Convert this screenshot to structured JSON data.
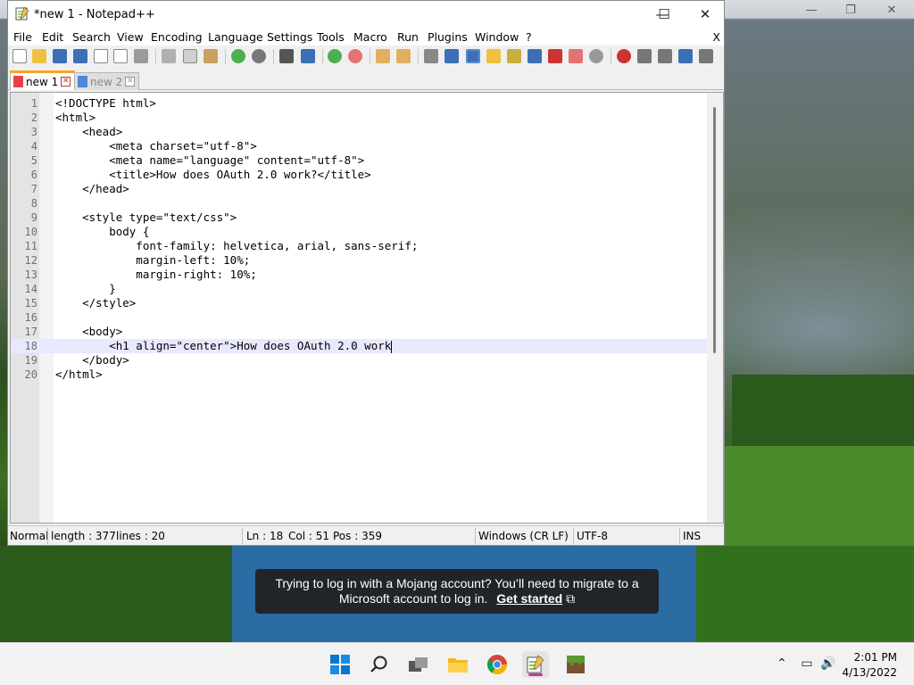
{
  "window": {
    "title": "*new 1 - Notepad++",
    "minimize": "—",
    "maximize": "☐",
    "close": "✕"
  },
  "menubar": {
    "items": [
      "File",
      "Edit",
      "Search",
      "View",
      "Encoding",
      "Language",
      "Settings",
      "Tools",
      "Macro",
      "Run",
      "Plugins",
      "Window",
      "?"
    ],
    "close_doc": "X"
  },
  "tabs": [
    {
      "label": "new 1",
      "active": true,
      "color": "#e8404a"
    },
    {
      "label": "new 2",
      "active": false,
      "color": "#4a8ad8"
    }
  ],
  "editor": {
    "current_line": 18,
    "lines": [
      {
        "n": "1",
        "text": "<!DOCTYPE html>"
      },
      {
        "n": "2",
        "text": "<html>"
      },
      {
        "n": "3",
        "text": "    <head>"
      },
      {
        "n": "4",
        "text": "        <meta charset=\"utf-8\">"
      },
      {
        "n": "5",
        "text": "        <meta name=\"language\" content=\"utf-8\">"
      },
      {
        "n": "6",
        "text": "        <title>How does OAuth 2.0 work?</title>"
      },
      {
        "n": "7",
        "text": "    </head>"
      },
      {
        "n": "8",
        "text": ""
      },
      {
        "n": "9",
        "text": "    <style type=\"text/css\">"
      },
      {
        "n": "10",
        "text": "        body {"
      },
      {
        "n": "11",
        "text": "            font-family: helvetica, arial, sans-serif;"
      },
      {
        "n": "12",
        "text": "            margin-left: 10%;"
      },
      {
        "n": "13",
        "text": "            margin-right: 10%;"
      },
      {
        "n": "14",
        "text": "        }"
      },
      {
        "n": "15",
        "text": "    </style>"
      },
      {
        "n": "16",
        "text": ""
      },
      {
        "n": "17",
        "text": "    <body>"
      },
      {
        "n": "18",
        "text": "        <h1 align=\"center\">How does OAuth 2.0 work"
      },
      {
        "n": "19",
        "text": "    </body>"
      },
      {
        "n": "20",
        "text": "</html>"
      }
    ]
  },
  "statusbar": {
    "mode": "Normal",
    "length": "length : 377",
    "lines": "lines : 20",
    "ln": "Ln : 18",
    "col": "Col : 51",
    "pos": "Pos : 359",
    "eol": "Windows (CR LF)",
    "encoding": "UTF-8",
    "ins": "INS"
  },
  "background_window": {
    "minimize": "—",
    "maximize": "❐",
    "close": "✕"
  },
  "toast": {
    "message_line1": "Trying to log in with a Mojang account? You’ll need to migrate to a",
    "message_line2": "Microsoft account to log in.",
    "link": "Get started",
    "link_icon": "⧉"
  },
  "taskbar": {
    "apps": [
      "windows-start-icon",
      "search-icon",
      "task-view-icon",
      "file-explorer-icon",
      "chrome-icon",
      "notepadpp-icon",
      "minecraft-icon"
    ],
    "tray": {
      "chevron": "⌃",
      "network": "▭",
      "volume": "🔊"
    },
    "time": "2:01 PM",
    "date": "4/13/2022"
  }
}
